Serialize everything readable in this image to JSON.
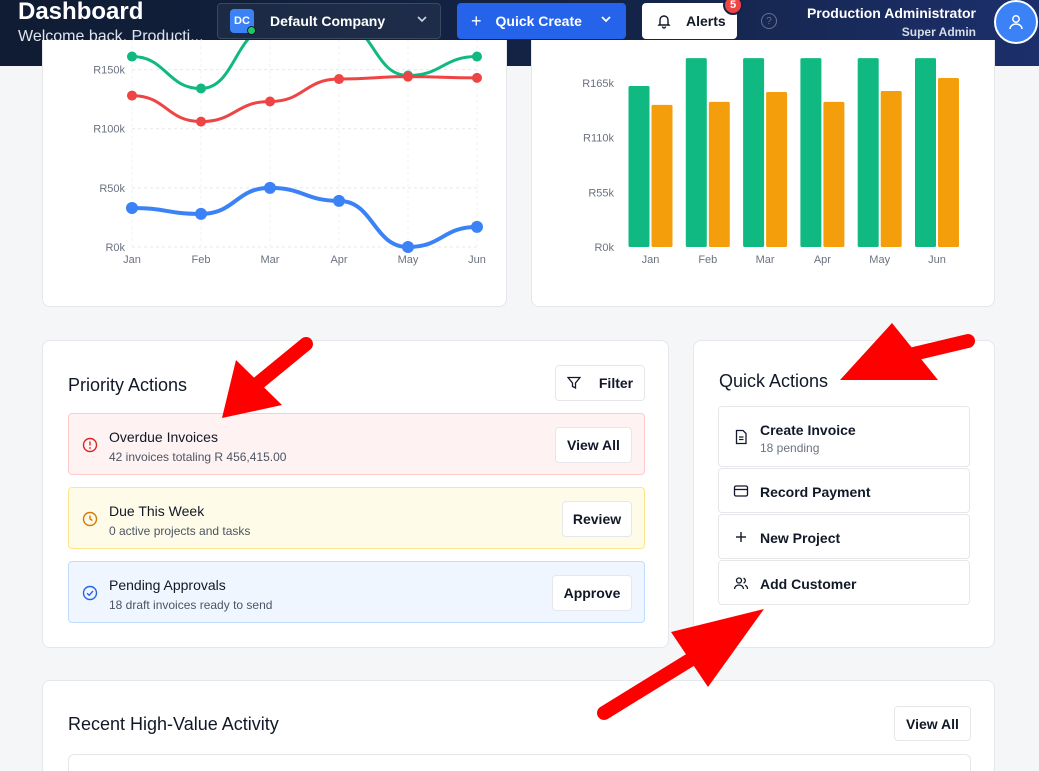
{
  "header": {
    "title": "Dashboard",
    "subtitle": "Welcome back, Producti...",
    "company": {
      "initials": "DC",
      "name": "Default Company"
    },
    "quick_create_label": "Quick Create",
    "alerts_label": "Alerts",
    "alerts_count": "5",
    "help_icon": "?",
    "user_name": "Production Administrator",
    "user_role": "Super Admin"
  },
  "chart_data": [
    {
      "type": "line",
      "x": [
        "Jan",
        "Feb",
        "Mar",
        "Apr",
        "May",
        "Jun"
      ],
      "ytick_labels": [
        "R0k",
        "R50k",
        "R100k",
        "R150k"
      ],
      "ylim": [
        0,
        175000
      ],
      "grid": true,
      "series": [
        {
          "color": "#10b981",
          "values": [
            161000,
            134000,
            185000,
            190000,
            145000,
            161000
          ]
        },
        {
          "color": "#ef4444",
          "values": [
            128000,
            106000,
            123000,
            142000,
            144000,
            143000
          ]
        },
        {
          "color": "#3b82f6",
          "values": [
            33000,
            28000,
            50000,
            39000,
            0,
            17000
          ]
        }
      ]
    },
    {
      "type": "bar",
      "categories": [
        "Jan",
        "Feb",
        "Mar",
        "Apr",
        "May",
        "Jun"
      ],
      "ytick_labels": [
        "R0k",
        "R55k",
        "R110k",
        "R165k"
      ],
      "ylim": [
        0,
        200000
      ],
      "series": [
        {
          "color": "#10b981",
          "values": [
            162000,
            190000,
            190000,
            190000,
            190000,
            190000
          ]
        },
        {
          "color": "#f59e0b",
          "values": [
            143000,
            146000,
            156000,
            146000,
            157000,
            170000
          ]
        }
      ]
    }
  ],
  "priority": {
    "title": "Priority Actions",
    "filter_label": "Filter",
    "items": [
      {
        "title": "Overdue Invoices",
        "subtitle": "42 invoices totaling R 456,415.00",
        "button": "View All"
      },
      {
        "title": "Due This Week",
        "subtitle": "0 active projects and tasks",
        "button": "Review"
      },
      {
        "title": "Pending Approvals",
        "subtitle": "18 draft invoices ready to send",
        "button": "Approve"
      }
    ]
  },
  "quick_actions": {
    "title": "Quick Actions",
    "items": [
      {
        "label": "Create Invoice",
        "sub": "18 pending"
      },
      {
        "label": "Record Payment"
      },
      {
        "label": "New Project"
      },
      {
        "label": "Add Customer"
      }
    ]
  },
  "recent": {
    "title": "Recent High-Value Activity",
    "view_all_label": "View All"
  },
  "colors": {
    "accent": "#2563eb",
    "annotation_arrow": "#ff0000"
  }
}
